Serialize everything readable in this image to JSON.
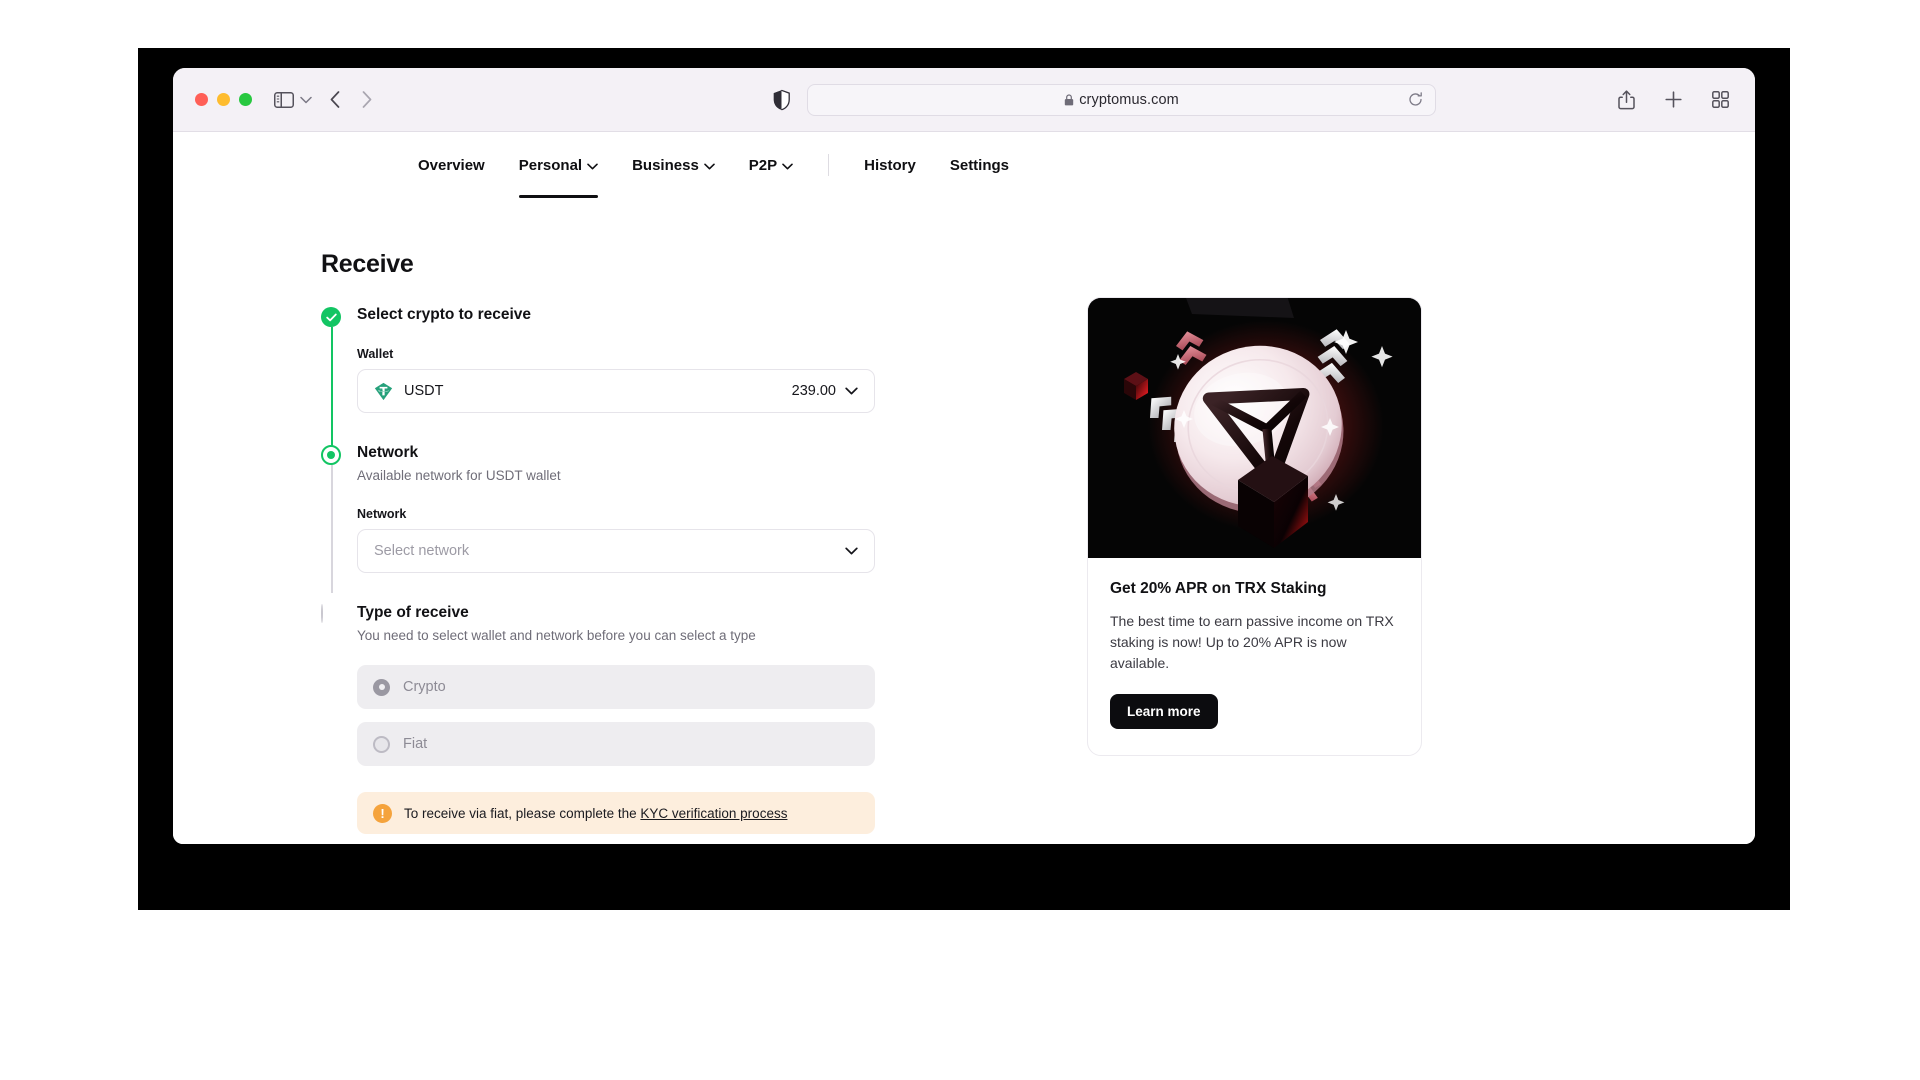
{
  "browser": {
    "url": "cryptomus.com",
    "lock_icon": "lock-icon",
    "reload_icon": "reload-icon",
    "sidebar_icon": "sidebar-toggle-icon",
    "shield_icon": "privacy-shield-icon",
    "back_icon": "back-arrow-icon",
    "forward_icon": "forward-arrow-icon",
    "share_icon": "share-icon",
    "new_tab_icon": "plus-icon",
    "tab_overview_icon": "tab-overview-icon"
  },
  "nav": {
    "items": [
      {
        "label": "Overview",
        "has_chevron": false,
        "active": false
      },
      {
        "label": "Personal",
        "has_chevron": true,
        "active": true
      },
      {
        "label": "Business",
        "has_chevron": true,
        "active": false
      },
      {
        "label": "P2P",
        "has_chevron": true,
        "active": false
      },
      {
        "label": "History",
        "has_chevron": false,
        "active": false
      },
      {
        "label": "Settings",
        "has_chevron": false,
        "active": false
      }
    ]
  },
  "page": {
    "title": "Receive"
  },
  "steps": {
    "crypto": {
      "title": "Select crypto to receive",
      "state": "done",
      "field_label": "Wallet",
      "wallet": {
        "icon": "usdt-icon",
        "name": "USDT",
        "amount": "239.00",
        "chevron": "chevron-down-icon"
      }
    },
    "network": {
      "title": "Network",
      "subtitle": "Available network for USDT wallet",
      "state": "current",
      "field_label": "Network",
      "placeholder": "Select network",
      "value": "",
      "chevron": "chevron-down-icon"
    },
    "type": {
      "title": "Type of receive",
      "subtitle": "You need to select wallet and network before you can select a type",
      "state": "todo",
      "options": [
        {
          "label": "Crypto",
          "selected": true,
          "disabled": true
        },
        {
          "label": "Fiat",
          "selected": false,
          "disabled": true
        }
      ],
      "alert": {
        "icon": "warning-icon",
        "text": "To receive via fiat, please complete the ",
        "link_text": "KYC verification process"
      }
    }
  },
  "promo": {
    "art_alt": "trx-coin-illustration",
    "title": "Get 20% APR on TRX Staking",
    "description": "The best time to earn passive income on TRX staking is now! Up to 20% APR is now available.",
    "button_label": "Learn more"
  },
  "colors": {
    "accent_green": "#12c563",
    "warning_orange": "#f5a33c",
    "alert_bg": "#fdeedd",
    "usdt_teal": "#26a17b",
    "dark": "#0c0c0f"
  }
}
